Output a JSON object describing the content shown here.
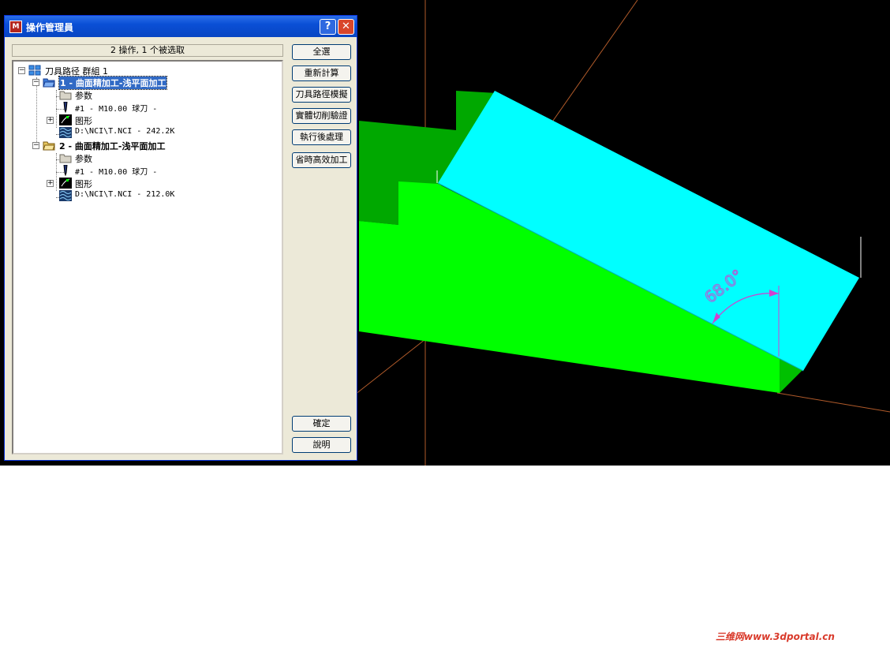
{
  "window": {
    "title": "操作管理員",
    "help_label": "?",
    "close_label": "✕"
  },
  "status": "2 操作, 1 个被选取",
  "tree": {
    "root": "刀具路径 群組 1",
    "operations": [
      {
        "label": "1 - 曲面精加工-浅平面加工",
        "params": "参数",
        "tool": "#1 - M10.00 球刀 -",
        "geometry": "图形",
        "nci": "D:\\NCI\\T.NCI - 242.2K"
      },
      {
        "label": "2 - 曲面精加工-浅平面加工",
        "params": "参数",
        "tool": "#1 - M10.00 球刀 -",
        "geometry": "图形",
        "nci": "D:\\NCI\\T.NCI - 212.0K"
      }
    ]
  },
  "buttons": {
    "select_all": "全選",
    "regenerate": "重新計算",
    "toolpath_sim": "刀具路徑模擬",
    "solid_verify": "實體切削驗證",
    "post_process": "執行後處理",
    "high_speed": "省時高效加工",
    "ok": "確定",
    "help": "說明"
  },
  "viewport": {
    "angle_label": "68.0°",
    "colors": {
      "background": "#000000",
      "solid": "#00ff00",
      "solid_dark": "#00a800",
      "plate": "#00ffff",
      "dimension": "#d040d0",
      "axis": "#b05a2a"
    }
  },
  "watermark": "三维网www.3dportal.cn"
}
